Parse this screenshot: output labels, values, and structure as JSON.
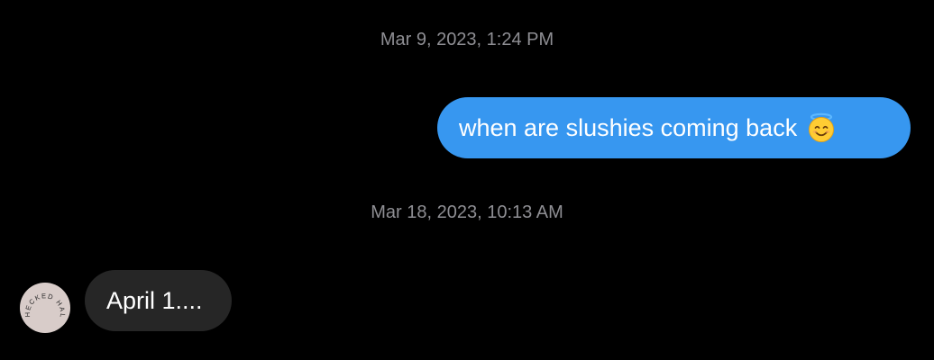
{
  "conversation": {
    "timestamps": [
      "Mar 9, 2023, 1:24 PM",
      "Mar 18, 2023, 10:13 AM"
    ],
    "messages": [
      {
        "direction": "outgoing",
        "text": "when are slushies coming back",
        "emoji": "smiling-face-with-halo"
      },
      {
        "direction": "incoming",
        "text": "April 1...."
      }
    ],
    "avatar": {
      "logo_text": "CHECKED HALL"
    }
  },
  "colors": {
    "background": "#000000",
    "outgoing_bubble": "#3797f0",
    "incoming_bubble": "#262626",
    "timestamp": "#8e8e93",
    "avatar_bg": "#d8ccc9"
  }
}
